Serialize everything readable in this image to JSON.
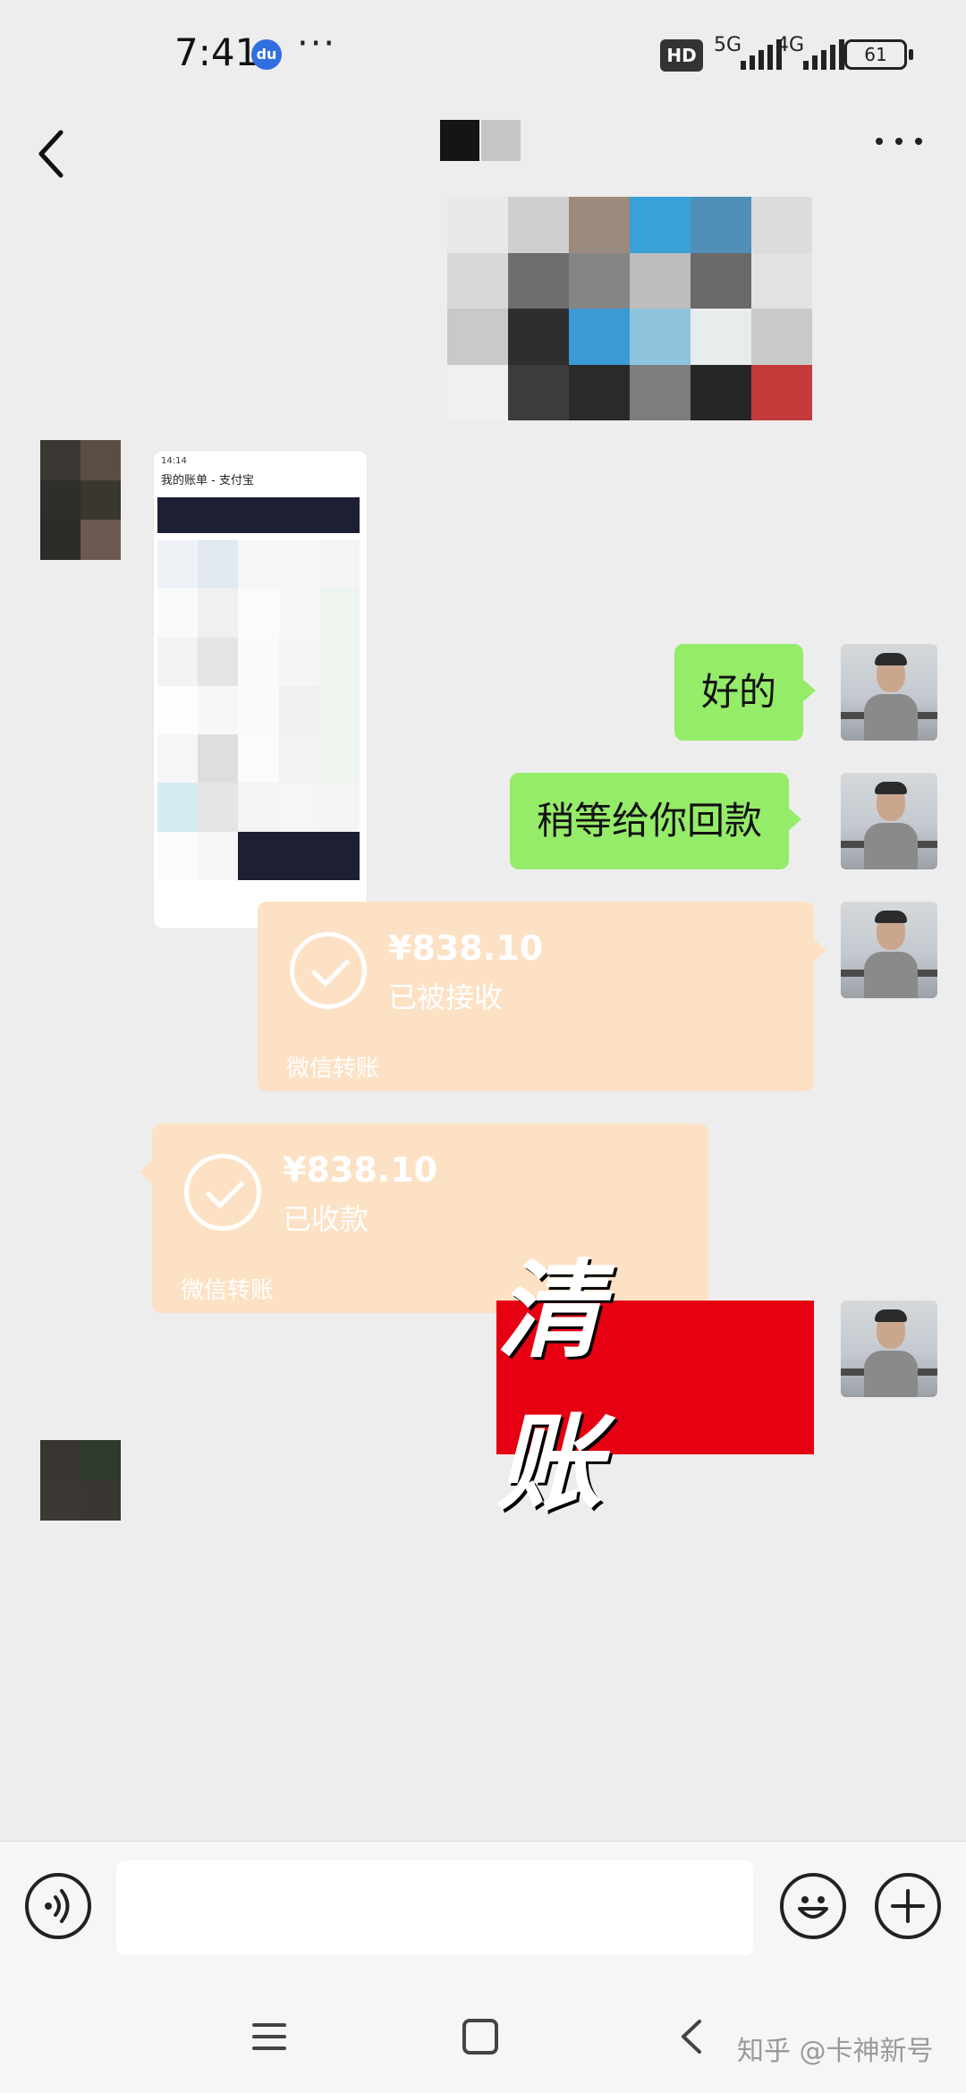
{
  "status_bar": {
    "time": "7:41",
    "more_glyph": "···",
    "hd_label": "HD",
    "signal1_label": "5G",
    "signal2_label": "4G",
    "battery": "61"
  },
  "header": {
    "back_icon": "chevron-left-icon",
    "more_icon": "more-horizontal-icon"
  },
  "messages": [
    {
      "type": "image",
      "side": "right",
      "content": "pixelated-image"
    },
    {
      "type": "image",
      "side": "left",
      "content": "screenshot-image"
    },
    {
      "type": "text",
      "side": "right",
      "text": "好的"
    },
    {
      "type": "text",
      "side": "right",
      "text": "稍等给你回款"
    },
    {
      "type": "transfer",
      "side": "right",
      "amount": "¥838.10",
      "status": "已被接收",
      "footer": "微信转账"
    },
    {
      "type": "transfer",
      "side": "left",
      "amount": "¥838.10",
      "status": "已收款",
      "footer": "微信转账"
    },
    {
      "type": "sticker",
      "side": "right",
      "text": "清 账"
    }
  ],
  "screenshot_thumb": {
    "time": "14:14",
    "title": "我的账单 - 支付宝"
  },
  "input_bar": {
    "voice_icon": "voice-icon",
    "emoji_icon": "emoji-icon",
    "plus_icon": "plus-icon"
  },
  "watermark": "知乎 @卡神新号",
  "colors": {
    "background": "#ededed",
    "self_bubble": "#95ec69",
    "transfer_bubble": "#fde1c4",
    "sticker_red": "#e60012"
  }
}
